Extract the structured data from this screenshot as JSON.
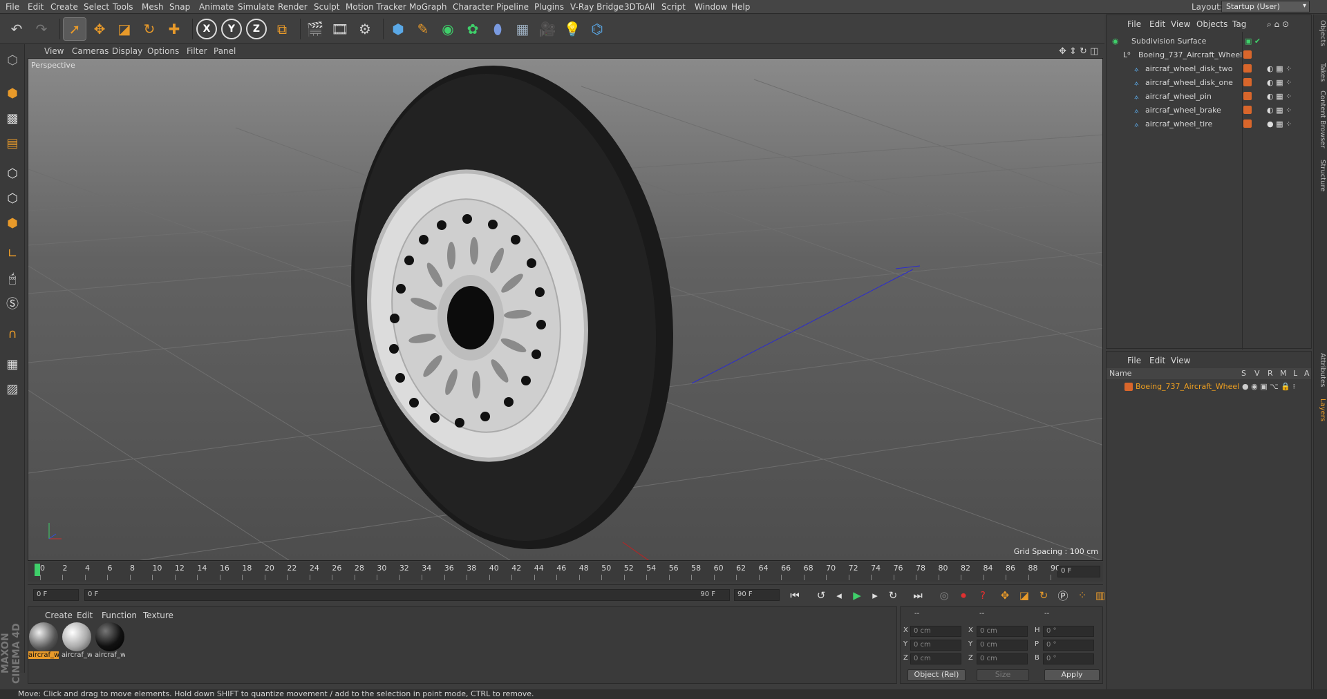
{
  "menu": [
    "File",
    "Edit",
    "Create",
    "Select",
    "Tools",
    "Mesh",
    "Snap",
    "Animate",
    "Simulate",
    "Render",
    "Sculpt",
    "Motion Tracker",
    "MoGraph",
    "Character",
    "Pipeline",
    "Plugins",
    "V-Ray Bridge",
    "3DToAll",
    "Script",
    "Window",
    "Help"
  ],
  "layout": {
    "label": "Layout:",
    "value": "Startup (User)"
  },
  "toolbar_axes": [
    "X",
    "Y",
    "Z"
  ],
  "viewport": {
    "menu": [
      "View",
      "Cameras",
      "Display",
      "Options",
      "Filter",
      "Panel"
    ],
    "label": "Perspective",
    "grid_spacing": "Grid Spacing : 100 cm"
  },
  "objects_panel": {
    "menu": [
      "File",
      "Edit",
      "View",
      "Objects",
      "Tag"
    ],
    "rows": [
      {
        "name": "Subdivision Surface",
        "indent": 0
      },
      {
        "name": "Boeing_737_Aircraft_Wheel",
        "indent": 1
      },
      {
        "name": "aircraf_wheel_disk_two",
        "indent": 2
      },
      {
        "name": "aircraf_wheel_disk_one",
        "indent": 2
      },
      {
        "name": "aircraf_wheel_pin",
        "indent": 2
      },
      {
        "name": "aircraf_wheel_brake",
        "indent": 2
      },
      {
        "name": "aircraf_wheel_tire",
        "indent": 2
      }
    ]
  },
  "layers_panel": {
    "menu": [
      "File",
      "Edit",
      "View"
    ],
    "columns": [
      "Name",
      "S",
      "V",
      "R",
      "M",
      "L",
      "A"
    ],
    "row": "Boeing_737_Aircraft_Wheel"
  },
  "side_tabs": [
    "Objects",
    "Takes",
    "Content Browser",
    "Structure",
    "Attributes",
    "Layers"
  ],
  "timeline": {
    "ticks": [
      "0",
      "2",
      "4",
      "6",
      "8",
      "10",
      "12",
      "14",
      "16",
      "18",
      "20",
      "22",
      "24",
      "26",
      "28",
      "30",
      "32",
      "34",
      "36",
      "38",
      "40",
      "42",
      "44",
      "46",
      "48",
      "50",
      "52",
      "54",
      "56",
      "58",
      "60",
      "62",
      "64",
      "66",
      "68",
      "70",
      "72",
      "74",
      "76",
      "78",
      "80",
      "82",
      "84",
      "86",
      "88",
      "90"
    ],
    "end_field": "0 F"
  },
  "transport": {
    "start": "0 F",
    "slider_start": "0 F",
    "slider_end": "90 F",
    "end": "90 F"
  },
  "material_panel": {
    "menu": [
      "Create",
      "Edit",
      "Function",
      "Texture"
    ],
    "materials": [
      "aircraf_w",
      "aircraf_w",
      "aircraf_w"
    ]
  },
  "coords": {
    "headers": [
      "--",
      "--",
      "--"
    ],
    "rows": [
      {
        "a": "X",
        "av": "0 cm",
        "b": "X",
        "bv": "0 cm",
        "c": "H",
        "cv": "0 °"
      },
      {
        "a": "Y",
        "av": "0 cm",
        "b": "Y",
        "bv": "0 cm",
        "c": "P",
        "cv": "0 °"
      },
      {
        "a": "Z",
        "av": "0 cm",
        "b": "Z",
        "bv": "0 cm",
        "c": "B",
        "cv": "0 °"
      }
    ],
    "mode": "Object (Rel)",
    "size": "Size",
    "apply": "Apply"
  },
  "brand": "MAXON CINEMA 4D",
  "status": "Move: Click and drag to move elements. Hold down SHIFT to quantize movement / add to the selection in point mode, CTRL to remove.",
  "colors": {
    "accent": "#e89a2a",
    "selected_text": "#f0a020",
    "tag_orange": "#d9662b"
  }
}
